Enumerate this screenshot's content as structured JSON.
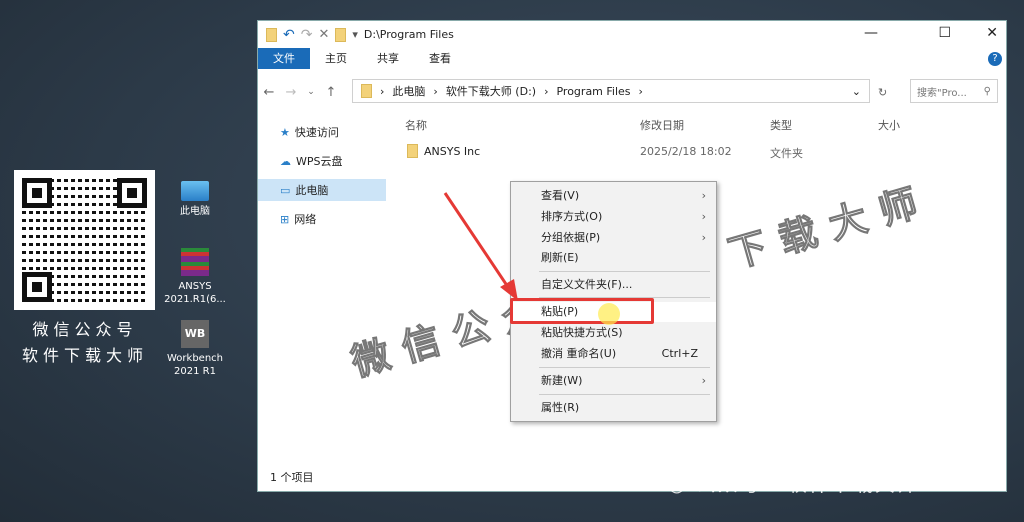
{
  "desktop": {
    "qr_caption_1": "微信公众号",
    "qr_caption_2": "软件下载大师",
    "icons": [
      {
        "label": "此电脑"
      },
      {
        "label": "ANSYS 2021.R1(6..."
      },
      {
        "label": "Workbench 2021 R1"
      }
    ]
  },
  "window": {
    "title": "D:\\Program Files",
    "ribbon_tabs": [
      "文件",
      "主页",
      "共享",
      "查看"
    ],
    "breadcrumb": [
      "此电脑",
      "软件下载大师 (D:)",
      "Program Files"
    ],
    "search_placeholder": "搜索\"Pro...",
    "sidebar": [
      "快速访问",
      "WPS云盘",
      "此电脑",
      "网络"
    ],
    "columns": [
      "名称",
      "修改日期",
      "类型",
      "大小"
    ],
    "rows": [
      {
        "name": "ANSYS Inc",
        "date": "2025/2/18 18:02",
        "type": "文件夹",
        "size": ""
      }
    ],
    "status": "1 个项目"
  },
  "context_menu": {
    "items": [
      {
        "label": "查看(V)"
      },
      {
        "label": "排序方式(O)"
      },
      {
        "label": "分组依据(P)"
      },
      {
        "label": "刷新(E)"
      },
      {
        "label": "自定义文件夹(F)..."
      },
      {
        "label": "粘贴(P)"
      },
      {
        "label": "粘贴快捷方式(S)"
      },
      {
        "label": "撤消 重命名(U)",
        "shortcut": "Ctrl+Z"
      },
      {
        "label": "新建(W)"
      },
      {
        "label": "属性(R)"
      }
    ]
  },
  "watermark": {
    "center": "微信公众号·软件下载大师",
    "bottom": "公众号 · 软件下载大师"
  },
  "colors": {
    "accent": "#1a6bb8",
    "highlight": "#e53935"
  }
}
